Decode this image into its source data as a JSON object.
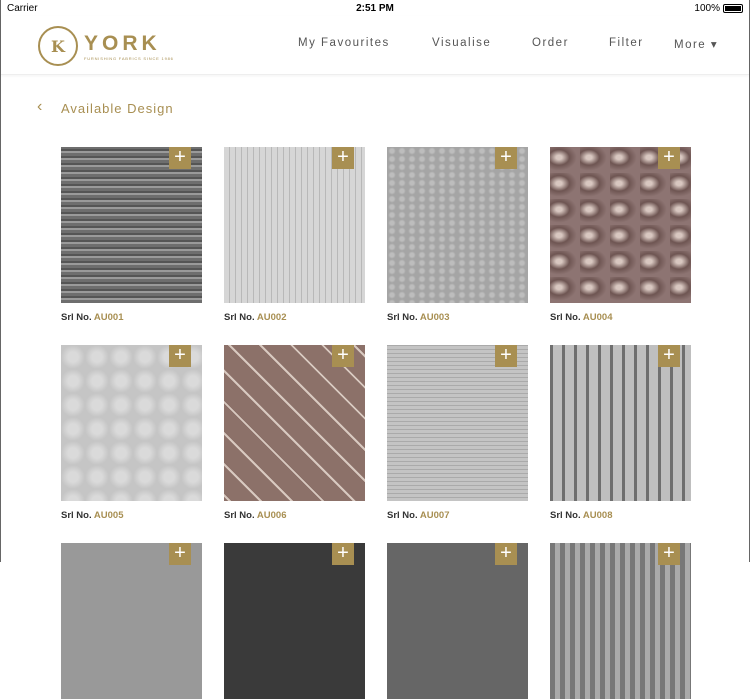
{
  "status": {
    "carrier": "Carrier",
    "time": "2:51 PM",
    "battery": "100%"
  },
  "brand": {
    "name": "YORK",
    "tagline": "FURNISHING FABRICS SINCE 1986",
    "seal": "K"
  },
  "nav": {
    "favourites": "My Favourites",
    "visualise": "Visualise",
    "order": "Order",
    "filter": "Filter",
    "more": "More ▾"
  },
  "page": {
    "back": "‹",
    "title": "Available Design"
  },
  "designs": [
    {
      "prefix": "Srl No.",
      "code": "AU001"
    },
    {
      "prefix": "Srl No.",
      "code": "AU002"
    },
    {
      "prefix": "Srl No.",
      "code": "AU003"
    },
    {
      "prefix": "Srl No.",
      "code": "AU004"
    },
    {
      "prefix": "Srl No.",
      "code": "AU005"
    },
    {
      "prefix": "Srl No.",
      "code": "AU006"
    },
    {
      "prefix": "Srl No.",
      "code": "AU007"
    },
    {
      "prefix": "Srl No.",
      "code": "AU008"
    }
  ],
  "add_icon": "+"
}
